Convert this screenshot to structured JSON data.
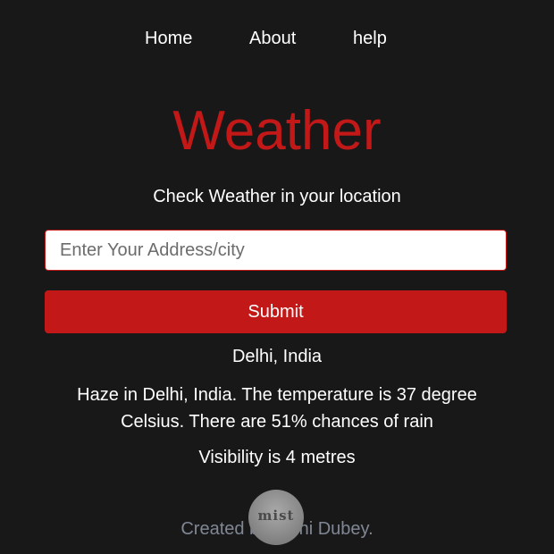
{
  "nav": {
    "items": [
      {
        "label": "Home"
      },
      {
        "label": "About"
      },
      {
        "label": "help"
      }
    ]
  },
  "header": {
    "title": "Weather",
    "subtitle": "Check Weather in your location"
  },
  "search": {
    "placeholder": "Enter Your Address/city",
    "value": "",
    "submit_label": "Submit"
  },
  "result": {
    "location": "Delhi, India",
    "description": "Haze in Delhi, India. The temperature is 37 degree Celsius. There are 51% chances of rain",
    "visibility": "Visibility is 4 metres",
    "icon": {
      "name": "mist-icon",
      "label": "mist"
    }
  },
  "footer": {
    "credit": "Created by Rishi Dubey."
  },
  "colors": {
    "background": "#191819",
    "accent": "#c21818",
    "text": "#ffffff",
    "footer_text": "#8b94a3"
  }
}
